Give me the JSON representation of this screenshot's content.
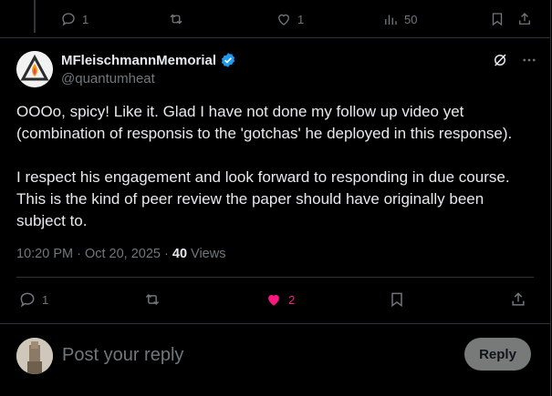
{
  "prev_tweet": {
    "replies": "1",
    "likes": "1",
    "views": "50"
  },
  "tweet": {
    "display_name": "MFleischmannMemorial",
    "handle": "@quantumheat",
    "text": "OOOo, spicy! Like it. Glad I have not done my follow up video yet (combination of responsis to the 'gotchas' he deployed in this response).\n\nI respect his engagement and look forward to responding in due course. This is the kind of peer review the paper should have originally been subject to.",
    "time": "10:20 PM · Oct 20, 2025 · ",
    "views_count": "40",
    "views_label": " Views",
    "replies": "1",
    "likes": "2"
  },
  "composer": {
    "placeholder": "Post your reply",
    "reply_label": "Reply"
  },
  "colors": {
    "background": "#000000",
    "text": "#e7e9ea",
    "muted": "#71767b",
    "verified": "#1d9bf0",
    "like_active": "#f91880",
    "reply_button": "#787a7a"
  },
  "icons": [
    "reply-icon",
    "repost-icon",
    "like-icon",
    "views-icon",
    "bookmark-icon",
    "share-icon",
    "verified-badge-icon",
    "grok-icon",
    "more-icon"
  ]
}
